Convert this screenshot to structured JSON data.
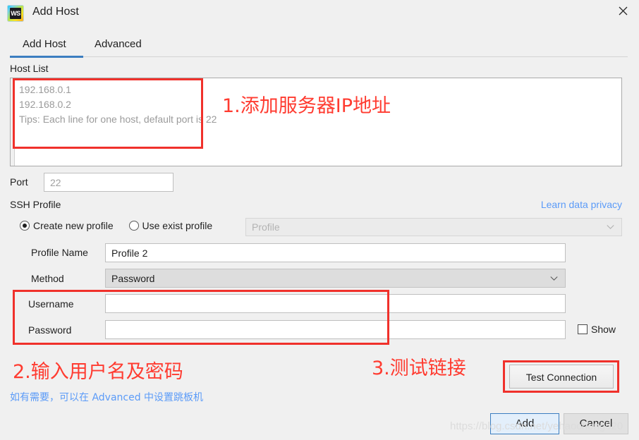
{
  "window": {
    "title": "Add Host",
    "app_icon": "webstorm-logo-icon",
    "logo_text": "WS",
    "close_icon": "close-icon"
  },
  "tabs": [
    {
      "label": "Add Host",
      "active": true
    },
    {
      "label": "Advanced",
      "active": false
    }
  ],
  "host_list": {
    "label": "Host List",
    "placeholder": "192.168.0.1\n192.168.0.2\nTips: Each line for one host, default port is 22",
    "value": ""
  },
  "port": {
    "label": "Port",
    "placeholder": "22",
    "value": ""
  },
  "ssh_profile": {
    "label": "SSH Profile",
    "privacy_link": "Learn data privacy",
    "radio_create": "Create new profile",
    "radio_exist": "Use exist profile",
    "selected_radio": "create",
    "profile_select_placeholder": "Profile",
    "profile_select_value": ""
  },
  "profile_name": {
    "label": "Profile Name",
    "value": "Profile 2"
  },
  "method": {
    "label": "Method",
    "value": "Password",
    "chevron_icon": "chevron-down-icon"
  },
  "username": {
    "label": "Username",
    "value": "",
    "placeholder": ""
  },
  "password": {
    "label": "Password",
    "value": "",
    "placeholder": "",
    "show_label": "Show",
    "show_checked": false
  },
  "test_connection": {
    "label": "Test Connection"
  },
  "footer": {
    "add_label": "Add",
    "cancel_label": "Cancel"
  },
  "annotations": {
    "step1": "1.添加服务器IP地址",
    "step2": "2.输入用户名及密码",
    "step3": "3.测试链接",
    "note": "如有需要，可以在 Advanced 中设置跳板机",
    "color": "#ff3b30",
    "note_color": "#5b9bf8"
  },
  "watermark": "https://blog.csdn.net/yehaocheng520"
}
